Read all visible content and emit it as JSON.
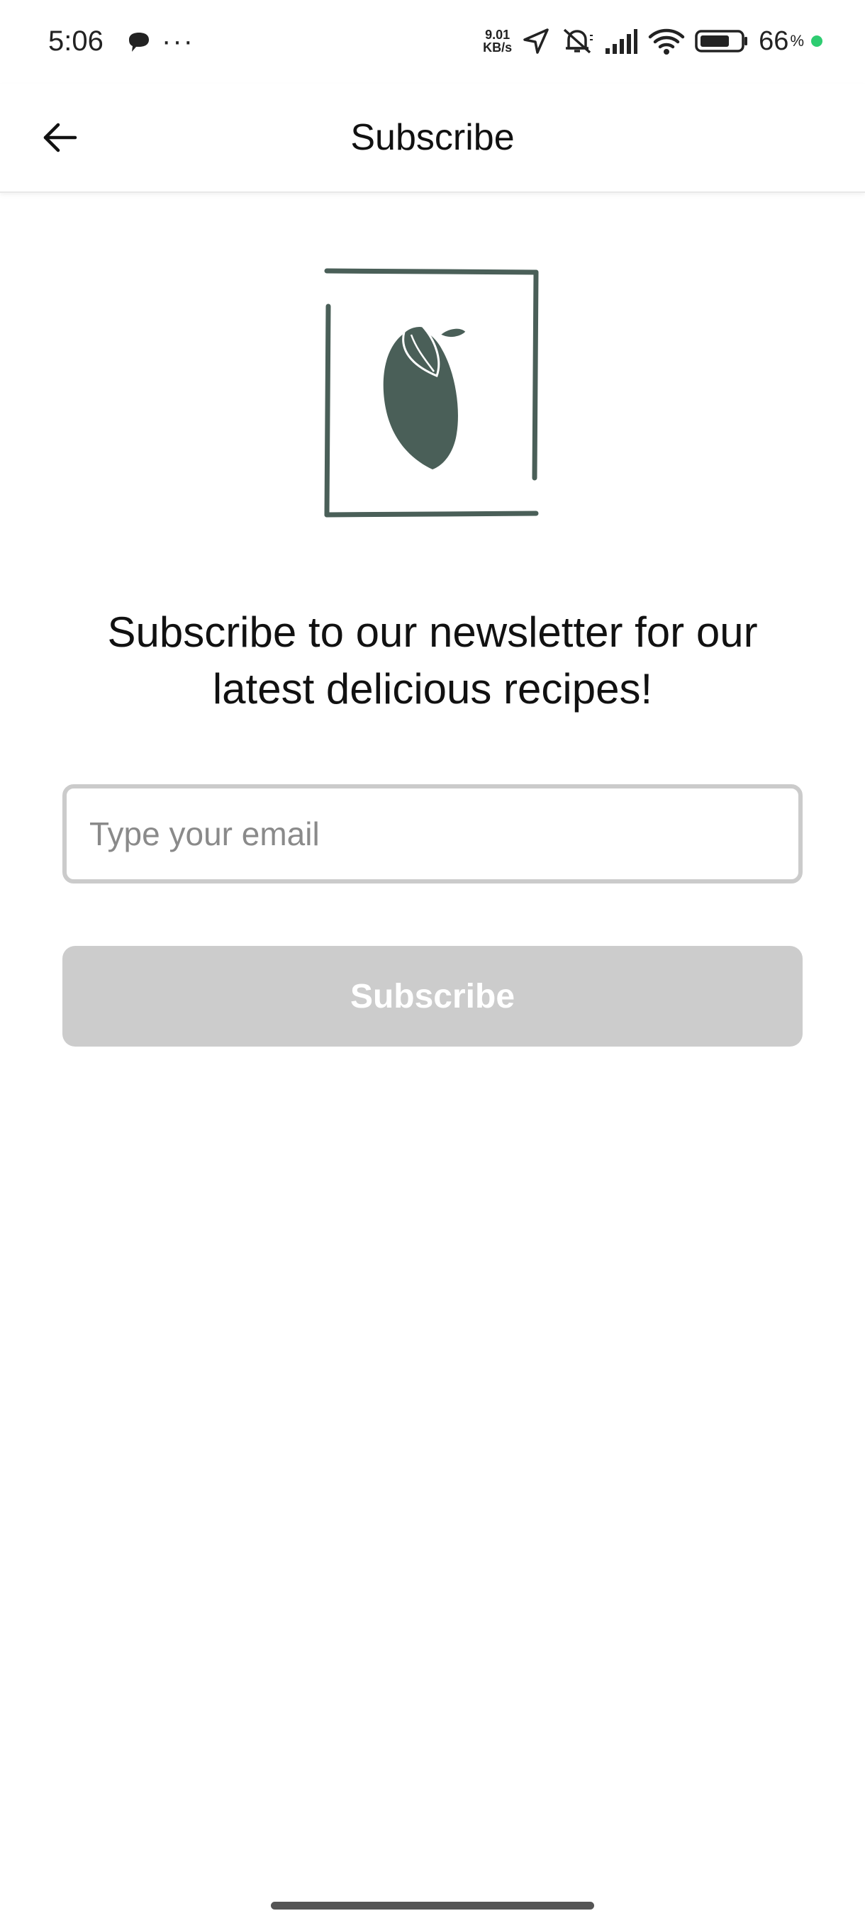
{
  "status_bar": {
    "time": "5:06",
    "more": "···",
    "net_speed_value": "9.01",
    "net_speed_unit": "KB/s",
    "battery_percent": "66",
    "battery_percent_sign": "%",
    "icons": [
      "chat-bubble-icon",
      "navigation-icon",
      "bell-muted-icon",
      "signal-icon",
      "wifi-icon",
      "battery-icon"
    ],
    "charging_dot_color": "#2ecc71"
  },
  "header": {
    "title": "Subscribe",
    "back_icon": "arrow-left-icon"
  },
  "logo": {
    "icon": "lemon-in-frame-icon",
    "color": "#4a5f58"
  },
  "main": {
    "headline_line1": "Subscribe to our newsletter for our",
    "headline_line2": "latest delicious recipes!",
    "email": {
      "placeholder": "Type your email",
      "value": ""
    },
    "subscribe_button_label": "Subscribe",
    "subscribe_button_color": "#cccccc"
  }
}
